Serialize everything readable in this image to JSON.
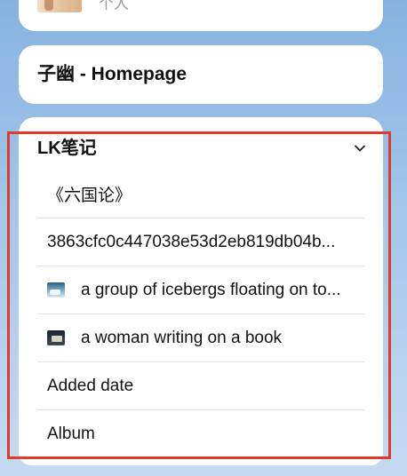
{
  "top_card": {
    "subtitle": "个人"
  },
  "homepage_card": {
    "title": "子幽 - Homepage"
  },
  "notes_section": {
    "title": "LK笔记",
    "expand_icon": "chevron-down-icon",
    "items": [
      {
        "label": "《六国论》"
      },
      {
        "label": "3863cfc0c447038e53d2eb819db04b..."
      },
      {
        "label": "a group of icebergs floating on to...",
        "icon": "icebergs-thumbnail"
      },
      {
        "label": "a woman writing on a book",
        "icon": "writing-thumbnail"
      },
      {
        "label": "Added date"
      },
      {
        "label": "Album"
      }
    ]
  },
  "colors": {
    "highlight_border": "#e23a2a",
    "card_bg": "#ffffff",
    "page_bg": "#a4c6ea"
  }
}
